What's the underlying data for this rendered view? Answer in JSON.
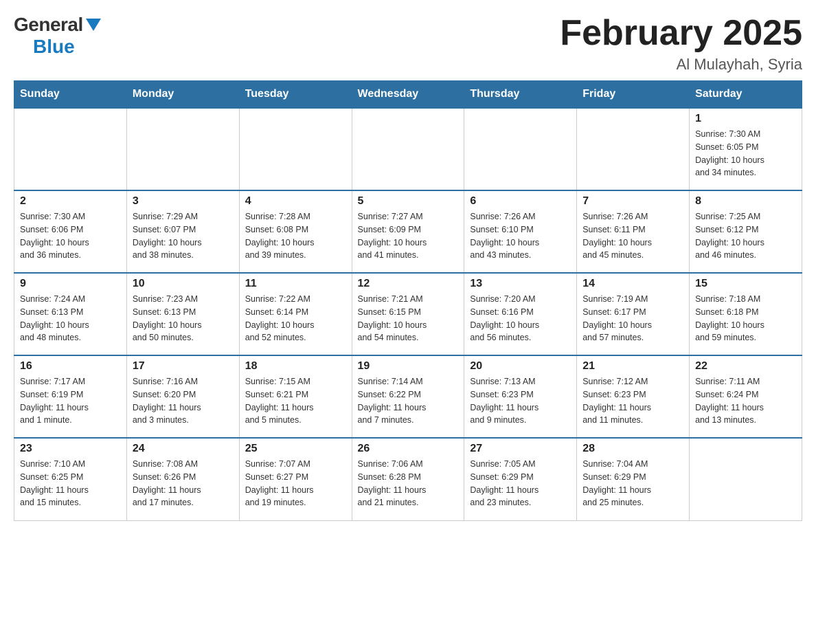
{
  "header": {
    "logo_general": "General",
    "logo_blue": "Blue",
    "month_title": "February 2025",
    "location": "Al Mulayhah, Syria"
  },
  "weekdays": [
    "Sunday",
    "Monday",
    "Tuesday",
    "Wednesday",
    "Thursday",
    "Friday",
    "Saturday"
  ],
  "weeks": [
    [
      {
        "day": "",
        "info": ""
      },
      {
        "day": "",
        "info": ""
      },
      {
        "day": "",
        "info": ""
      },
      {
        "day": "",
        "info": ""
      },
      {
        "day": "",
        "info": ""
      },
      {
        "day": "",
        "info": ""
      },
      {
        "day": "1",
        "info": "Sunrise: 7:30 AM\nSunset: 6:05 PM\nDaylight: 10 hours\nand 34 minutes."
      }
    ],
    [
      {
        "day": "2",
        "info": "Sunrise: 7:30 AM\nSunset: 6:06 PM\nDaylight: 10 hours\nand 36 minutes."
      },
      {
        "day": "3",
        "info": "Sunrise: 7:29 AM\nSunset: 6:07 PM\nDaylight: 10 hours\nand 38 minutes."
      },
      {
        "day": "4",
        "info": "Sunrise: 7:28 AM\nSunset: 6:08 PM\nDaylight: 10 hours\nand 39 minutes."
      },
      {
        "day": "5",
        "info": "Sunrise: 7:27 AM\nSunset: 6:09 PM\nDaylight: 10 hours\nand 41 minutes."
      },
      {
        "day": "6",
        "info": "Sunrise: 7:26 AM\nSunset: 6:10 PM\nDaylight: 10 hours\nand 43 minutes."
      },
      {
        "day": "7",
        "info": "Sunrise: 7:26 AM\nSunset: 6:11 PM\nDaylight: 10 hours\nand 45 minutes."
      },
      {
        "day": "8",
        "info": "Sunrise: 7:25 AM\nSunset: 6:12 PM\nDaylight: 10 hours\nand 46 minutes."
      }
    ],
    [
      {
        "day": "9",
        "info": "Sunrise: 7:24 AM\nSunset: 6:13 PM\nDaylight: 10 hours\nand 48 minutes."
      },
      {
        "day": "10",
        "info": "Sunrise: 7:23 AM\nSunset: 6:13 PM\nDaylight: 10 hours\nand 50 minutes."
      },
      {
        "day": "11",
        "info": "Sunrise: 7:22 AM\nSunset: 6:14 PM\nDaylight: 10 hours\nand 52 minutes."
      },
      {
        "day": "12",
        "info": "Sunrise: 7:21 AM\nSunset: 6:15 PM\nDaylight: 10 hours\nand 54 minutes."
      },
      {
        "day": "13",
        "info": "Sunrise: 7:20 AM\nSunset: 6:16 PM\nDaylight: 10 hours\nand 56 minutes."
      },
      {
        "day": "14",
        "info": "Sunrise: 7:19 AM\nSunset: 6:17 PM\nDaylight: 10 hours\nand 57 minutes."
      },
      {
        "day": "15",
        "info": "Sunrise: 7:18 AM\nSunset: 6:18 PM\nDaylight: 10 hours\nand 59 minutes."
      }
    ],
    [
      {
        "day": "16",
        "info": "Sunrise: 7:17 AM\nSunset: 6:19 PM\nDaylight: 11 hours\nand 1 minute."
      },
      {
        "day": "17",
        "info": "Sunrise: 7:16 AM\nSunset: 6:20 PM\nDaylight: 11 hours\nand 3 minutes."
      },
      {
        "day": "18",
        "info": "Sunrise: 7:15 AM\nSunset: 6:21 PM\nDaylight: 11 hours\nand 5 minutes."
      },
      {
        "day": "19",
        "info": "Sunrise: 7:14 AM\nSunset: 6:22 PM\nDaylight: 11 hours\nand 7 minutes."
      },
      {
        "day": "20",
        "info": "Sunrise: 7:13 AM\nSunset: 6:23 PM\nDaylight: 11 hours\nand 9 minutes."
      },
      {
        "day": "21",
        "info": "Sunrise: 7:12 AM\nSunset: 6:23 PM\nDaylight: 11 hours\nand 11 minutes."
      },
      {
        "day": "22",
        "info": "Sunrise: 7:11 AM\nSunset: 6:24 PM\nDaylight: 11 hours\nand 13 minutes."
      }
    ],
    [
      {
        "day": "23",
        "info": "Sunrise: 7:10 AM\nSunset: 6:25 PM\nDaylight: 11 hours\nand 15 minutes."
      },
      {
        "day": "24",
        "info": "Sunrise: 7:08 AM\nSunset: 6:26 PM\nDaylight: 11 hours\nand 17 minutes."
      },
      {
        "day": "25",
        "info": "Sunrise: 7:07 AM\nSunset: 6:27 PM\nDaylight: 11 hours\nand 19 minutes."
      },
      {
        "day": "26",
        "info": "Sunrise: 7:06 AM\nSunset: 6:28 PM\nDaylight: 11 hours\nand 21 minutes."
      },
      {
        "day": "27",
        "info": "Sunrise: 7:05 AM\nSunset: 6:29 PM\nDaylight: 11 hours\nand 23 minutes."
      },
      {
        "day": "28",
        "info": "Sunrise: 7:04 AM\nSunset: 6:29 PM\nDaylight: 11 hours\nand 25 minutes."
      },
      {
        "day": "",
        "info": ""
      }
    ]
  ]
}
